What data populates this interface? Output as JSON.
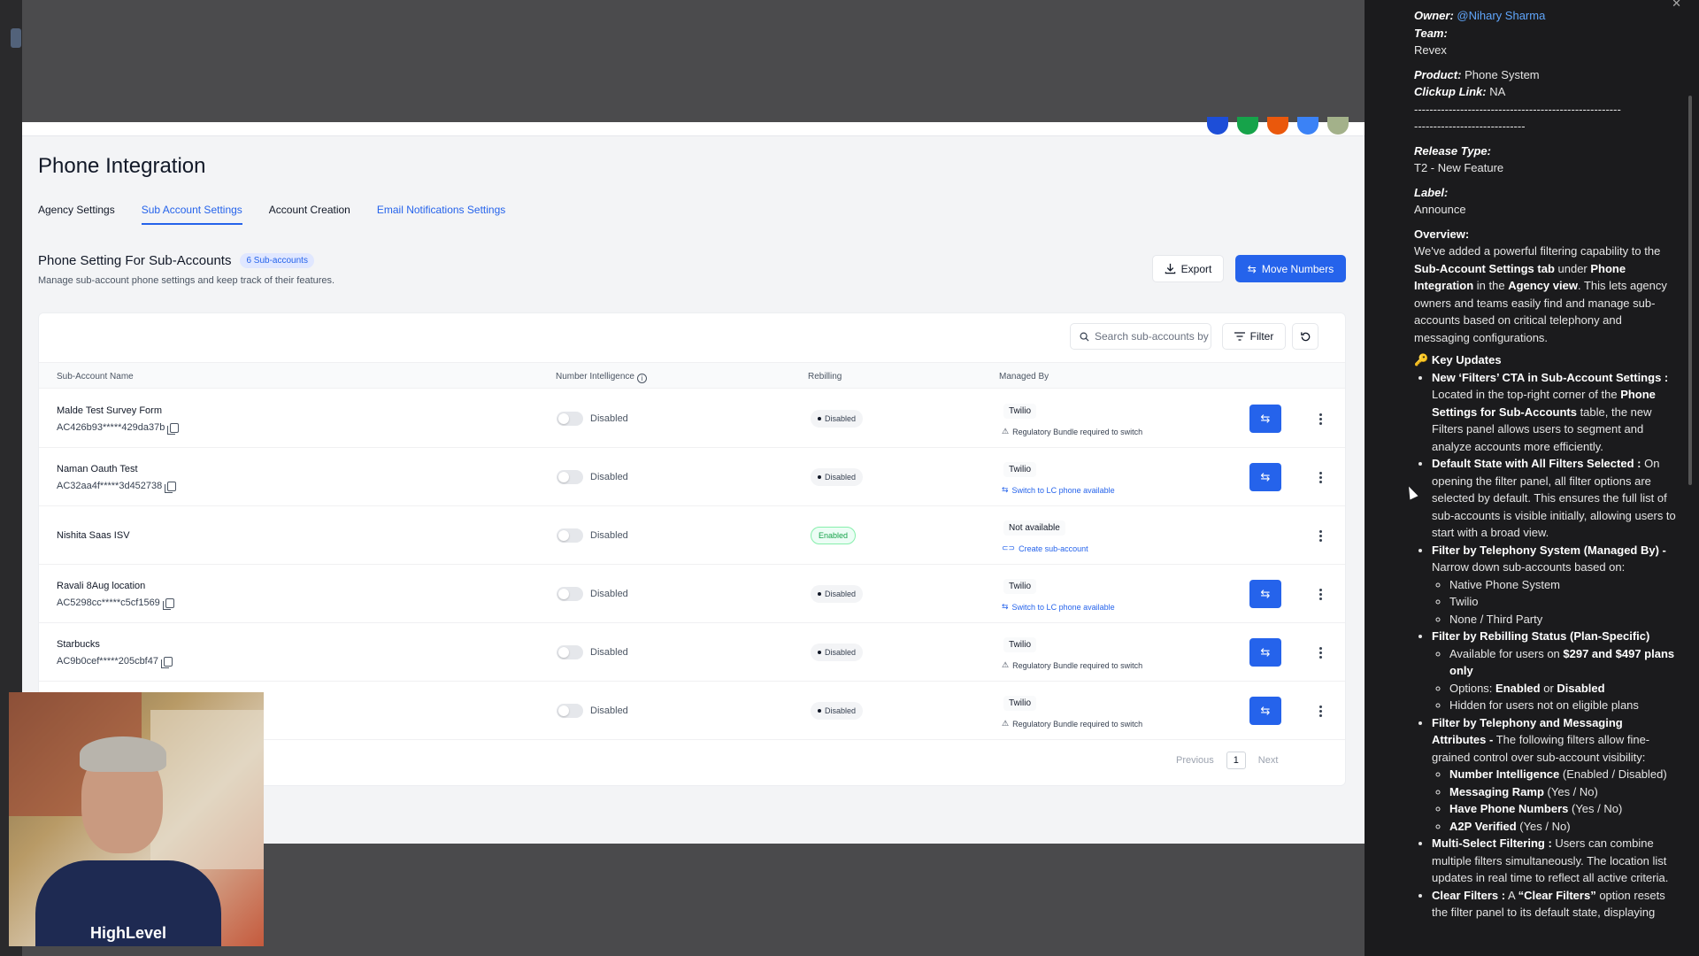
{
  "app": {
    "page_title": "Phone Integration",
    "tabs": [
      {
        "label": "Agency Settings"
      },
      {
        "label": "Sub Account Settings"
      },
      {
        "label": "Account Creation"
      },
      {
        "label": "Email Notifications Settings"
      }
    ],
    "section": {
      "title": "Phone Setting For Sub-Accounts",
      "badge": "6 Sub-accounts",
      "subtitle": "Manage sub-account phone settings and keep track of their features."
    },
    "buttons": {
      "export": "Export",
      "move_numbers": "Move Numbers",
      "filter": "Filter"
    },
    "search": {
      "placeholder": "Search sub-accounts by"
    },
    "columns": {
      "name": "Sub-Account Name",
      "number_intelligence": "Number Intelligence",
      "rebilling": "Rebilling",
      "managed_by": "Managed By"
    },
    "rows": [
      {
        "name": "Malde Test Survey Form",
        "sid": "AC426b93*****429da37b",
        "toggle": "Disabled",
        "rebilling": "Disabled",
        "managed": "Twilio",
        "note": "Regulatory Bundle required to switch"
      },
      {
        "name": "Naman Oauth Test",
        "sid": "AC32aa4f*****3d452738",
        "toggle": "Disabled",
        "rebilling": "Disabled",
        "managed": "Twilio",
        "note": "Switch to LC phone available"
      },
      {
        "name": "Nishita Saas ISV",
        "sid": "",
        "toggle": "Disabled",
        "rebilling": "Enabled",
        "managed": "Not available",
        "note": "Create sub-account"
      },
      {
        "name": "Ravali 8Aug location",
        "sid": "AC5298cc*****c5cf1569",
        "toggle": "Disabled",
        "rebilling": "Disabled",
        "managed": "Twilio",
        "note": "Switch to LC phone available"
      },
      {
        "name": "Starbucks",
        "sid": "AC9b0cef*****205cbf47",
        "toggle": "Disabled",
        "rebilling": "Disabled",
        "managed": "Twilio",
        "note": "Regulatory Bundle required to switch"
      },
      {
        "name": "",
        "sid": "",
        "toggle": "Disabled",
        "rebilling": "Disabled",
        "managed": "Twilio",
        "note": "Regulatory Bundle required to switch"
      }
    ],
    "pagination": {
      "previous": "Previous",
      "page": "1",
      "next": "Next"
    }
  },
  "webcam": {
    "brand": "HighLevel"
  },
  "doc": {
    "owner_label": "Owner:",
    "owner_value": "@Nihary Sharma",
    "team_label": "Team:",
    "team_value": "Revex",
    "product_label": "Product:",
    "product_value": "Phone System",
    "clickup_label": "Clickup Link:",
    "clickup_value": "NA",
    "divider1": "------------------------------------------------------",
    "divider2": "-----------------------------",
    "release_label": "Release Type:",
    "release_value": "T2 - New Feature",
    "label_label": "Label:",
    "label_value": "Announce",
    "overview_label": "Overview:",
    "overview": {
      "p1": "We've added a powerful filtering capability to the ",
      "b1": "Sub-Account Settings tab",
      "p2": " under ",
      "b2": "Phone Integration",
      "p3": " in the ",
      "b3": "Agency view",
      "p4": ". This lets agency owners and teams easily find and manage sub-accounts based on critical telephony and messaging configurations."
    },
    "key_updates_title": "Key Updates",
    "updates": {
      "u1_b": "New ‘Filters’ CTA in Sub-Account Settings :",
      "u1_t1": " Located in the top-right corner of the ",
      "u1_b2": "Phone Settings for Sub-Accounts",
      "u1_t2": " table, the new Filters panel allows users to segment and analyze accounts more efficiently.",
      "u2_b": "Default State with All Filters Selected :",
      "u2_t": " On opening the filter panel, all filter options are selected by default. This ensures the full list of sub-accounts is visible initially, allowing users to start with a broad view.",
      "u3_b": "Filter by Telephony System (Managed By) -",
      "u3_t": " Narrow down sub-accounts based on:",
      "u3_s": [
        "Native Phone System",
        "Twilio",
        "None / Third Party"
      ],
      "u4_b": "Filter by Rebilling Status (Plan-Specific)",
      "u4_s1_t": "Available for users on ",
      "u4_s1_b": "$297 and $497 plans only",
      "u4_s2_t": "Options: ",
      "u4_s2_b1": "Enabled",
      "u4_s2_or": " or ",
      "u4_s2_b2": "Disabled",
      "u4_s3": "Hidden for users not on eligible plans",
      "u5_b": "Filter by Telephony and Messaging Attributes -",
      "u5_t": " The following filters allow fine-grained control over sub-account visibility:",
      "u5_s": [
        {
          "b": "Number Intelligence",
          "t": " (Enabled / Disabled)"
        },
        {
          "b": "Messaging Ramp",
          "t": " (Yes / No)"
        },
        {
          "b": "Have Phone Numbers",
          "t": " (Yes / No)"
        },
        {
          "b": "A2P Verified",
          "t": " (Yes / No)"
        }
      ],
      "u6_b": "Multi-Select Filtering :",
      "u6_t": " Users can combine multiple filters simultaneously. The location list updates in real time to reflect all active criteria.",
      "u7_b": "Clear Filters :",
      "u7_t1": " A ",
      "u7_b2": "“Clear Filters”",
      "u7_t2": " option resets the filter panel to its default state, displaying"
    }
  },
  "colors": {
    "accent": "#2563eb",
    "enabled": "#16a34a",
    "panel_bg": "#1b1b1d"
  }
}
